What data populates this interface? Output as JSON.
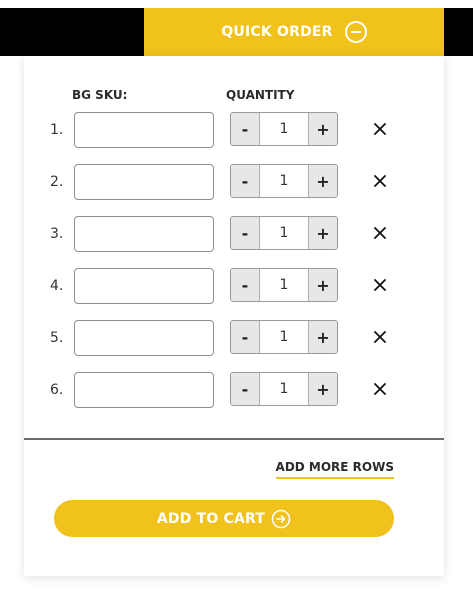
{
  "header": {
    "tab_label": "QUICK ORDER",
    "tab_icon": "collapse-circle-minus-icon"
  },
  "form": {
    "sku_header": "BG SKU:",
    "quantity_header": "QUANTITY",
    "rows": [
      {
        "number": "1.",
        "sku": "",
        "quantity": "1"
      },
      {
        "number": "2.",
        "sku": "",
        "quantity": "1"
      },
      {
        "number": "3.",
        "sku": "",
        "quantity": "1"
      },
      {
        "number": "4.",
        "sku": "",
        "quantity": "1"
      },
      {
        "number": "5.",
        "sku": "",
        "quantity": "1"
      },
      {
        "number": "6.",
        "sku": "",
        "quantity": "1"
      }
    ],
    "decrement_label": "-",
    "increment_label": "+",
    "add_more_label": "ADD MORE ROWS",
    "add_to_cart_label": "ADD TO CART",
    "add_to_cart_icon": "arrow-right-circle-icon"
  },
  "colors": {
    "accent": "#f1c21c",
    "top_bar": "#000000"
  }
}
